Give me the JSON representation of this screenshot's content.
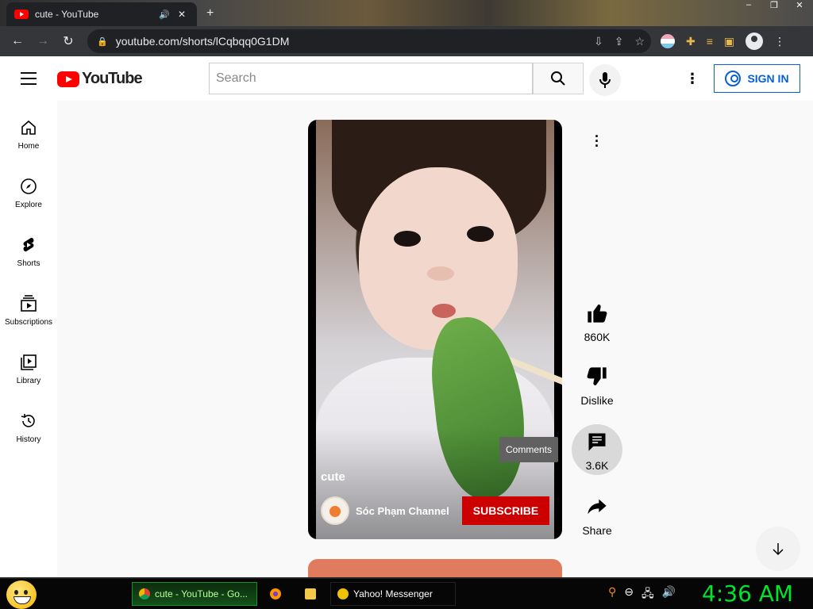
{
  "browser": {
    "tab_title": "cute - YouTube",
    "tab_audio_icon": "speaker-icon",
    "tab_close": "✕",
    "new_tab": "+",
    "url": "youtube.com/shorts/lCqbqq0G1DM",
    "window_controls": [
      "–",
      "❐",
      "✕"
    ]
  },
  "youtube": {
    "logo_text": "YouTube",
    "search_placeholder": "Search",
    "sign_in_label": "SIGN IN",
    "guide": [
      {
        "label": "Home",
        "icon": "home-icon"
      },
      {
        "label": "Explore",
        "icon": "compass-icon"
      },
      {
        "label": "Shorts",
        "icon": "shorts-icon"
      },
      {
        "label": "Subscriptions",
        "icon": "subscriptions-icon"
      },
      {
        "label": "Library",
        "icon": "library-icon"
      },
      {
        "label": "History",
        "icon": "history-icon"
      }
    ],
    "short": {
      "title": "cute",
      "channel": "Sóc Phạm Channel",
      "subscribe_label": "SUBSCRIBE",
      "likes": "860K",
      "dislike_label": "Dislike",
      "comments": "3.6K",
      "comments_tooltip": "Comments",
      "share_label": "Share"
    }
  },
  "taskbar": {
    "tasks": [
      {
        "label": "cute - YouTube - Go...",
        "icon": "chrome-icon",
        "active": true
      },
      {
        "label": "",
        "icon": "firefox-icon",
        "active": false
      },
      {
        "label": "",
        "icon": "folder-icon",
        "active": false
      },
      {
        "label": "Yahoo! Messenger",
        "icon": "yahoo-messenger-icon",
        "active": false
      }
    ],
    "clock": "4:36 AM"
  },
  "colors": {
    "youtube_red": "#ff0000",
    "subscribe_red": "#cc0000",
    "sign_in_blue": "#065fd4",
    "clock_green": "#00e52b"
  }
}
